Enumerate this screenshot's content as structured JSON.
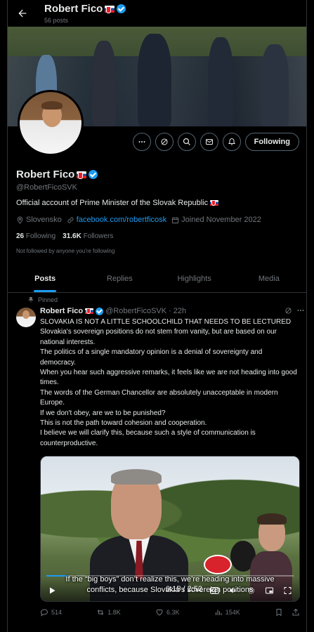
{
  "header": {
    "name": "Robert Fico",
    "posts_count": "56 posts"
  },
  "profile": {
    "name": "Robert Fico",
    "handle": "@RobertFicoSVK",
    "bio": "Official account of Prime Minister of the Slovak Republic",
    "location": "Slovensko",
    "website": "facebook.com/robertficosk",
    "joined": "Joined November 2022",
    "following_count": "26",
    "following_label": "Following",
    "followers_count": "31.6K",
    "followers_label": "Followers",
    "not_followed_text": "Not followed by anyone you're following",
    "follow_button_label": "Following"
  },
  "tabs": [
    "Posts",
    "Replies",
    "Highlights",
    "Media"
  ],
  "pinned_post": {
    "pinned_label": "Pinned",
    "author_name": "Robert Fico",
    "author_handle": "@RobertFicoSVK",
    "separator": "·",
    "time": "22h",
    "lines": [
      "SLOVAKIA IS NOT A LITTLE SCHOOLCHILD THAT NEEDS TO BE LECTURED",
      "Slovakia's sovereign positions do not stem from vanity, but are based on our national interests.",
      "The politics of a single mandatory opinion is a denial of sovereignty and democracy.",
      "When you hear such aggressive remarks, it feels like we are not heading into good times.",
      "The words of the German Chancellor are absolutely unacceptable in modern Europe.",
      "If we don't obey, are we to be punished?",
      "This is not the path toward cohesion and cooperation.",
      "I believe we will clarify this, because such a style of communication is counterproductive."
    ],
    "video": {
      "caption": "If the “big boys” don’t realize this, we’re heading into massive conflicts, because Slovakia’s sovereign positions",
      "time": "0:15 / 2:52",
      "progress": 0.087
    },
    "stats": {
      "replies": "514",
      "reposts": "1.8K",
      "likes": "6.3K",
      "views": "154K"
    }
  },
  "colors": {
    "accent": "#1d9bf0",
    "background": "#000000",
    "muted": "#71767b",
    "border": "#2f3336",
    "flag_white": "#ffffff",
    "flag_blue": "#0b4ea2",
    "flag_red": "#ee1c25"
  },
  "icons": [
    "back-arrow-icon",
    "slovak-flag-icon",
    "verified-badge-icon",
    "more-icon",
    "grok-icon",
    "search-icon",
    "message-icon",
    "notify-icon",
    "location-icon",
    "link-icon",
    "calendar-icon",
    "pin-icon",
    "play-icon",
    "cc-icon",
    "volume-icon",
    "settings-icon",
    "pip-icon",
    "fullscreen-icon",
    "reply-icon",
    "repost-icon",
    "like-icon",
    "views-icon",
    "bookmark-icon",
    "share-icon"
  ]
}
